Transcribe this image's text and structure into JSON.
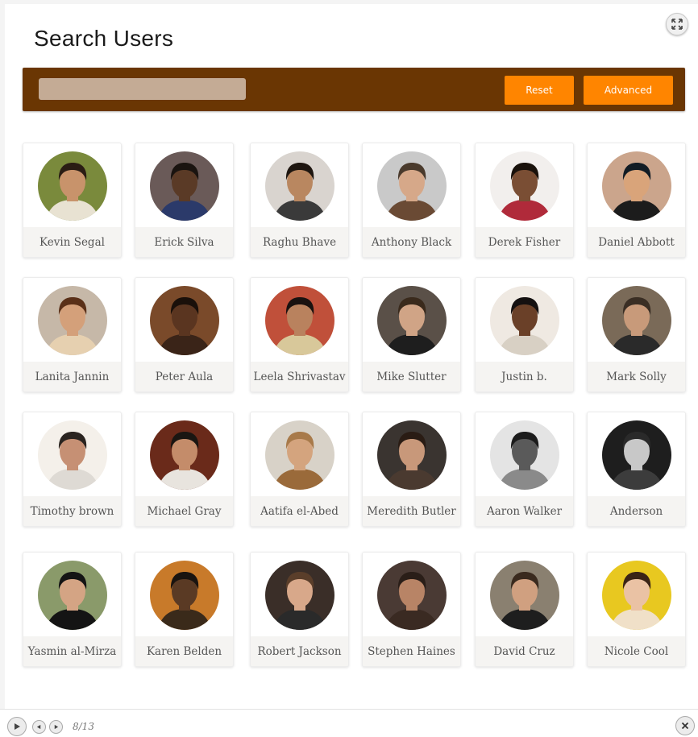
{
  "page": {
    "title": "Search Users"
  },
  "search": {
    "placeholder": "",
    "value": "",
    "reset_label": "Reset",
    "advanced_label": "Advanced"
  },
  "colors": {
    "search_bar_bg": "#6a3603",
    "search_input_bg": "#c4ab95",
    "button_bg": "#ff8500",
    "card_band_bg": "#f5f4f2"
  },
  "users": [
    {
      "name": "Kevin Segal",
      "bg": "#7a8a3c",
      "skin": "#c8936b",
      "hair": "#2a1d14",
      "shirt": "#e8e2d2"
    },
    {
      "name": "Erick Silva",
      "bg": "#6a5a58",
      "skin": "#5a3a26",
      "hair": "#1a1410",
      "shirt": "#2b3a6a"
    },
    {
      "name": "Raghu Bhave",
      "bg": "#d9d4cf",
      "skin": "#b98760",
      "hair": "#1e1610",
      "shirt": "#3a3a3a"
    },
    {
      "name": "Anthony Black",
      "bg": "#c9c9c9",
      "skin": "#d6a889",
      "hair": "#4a3a2c",
      "shirt": "#6a4a34"
    },
    {
      "name": "Derek Fisher",
      "bg": "#f2efed",
      "skin": "#7a4e34",
      "hair": "#1a120c",
      "shirt": "#b02a3a"
    },
    {
      "name": "Daniel Abbott",
      "bg": "#cba58c",
      "skin": "#d9a47a",
      "hair": "#121c24",
      "shirt": "#1c1c1c"
    },
    {
      "name": "Lanita Jannin",
      "bg": "#c6b8a8",
      "skin": "#d4a07a",
      "hair": "#5a3018",
      "shirt": "#e6d0b0"
    },
    {
      "name": "Peter Aula",
      "bg": "#7a4a2a",
      "skin": "#5a3520",
      "hair": "#1a100a",
      "shirt": "#3a2418"
    },
    {
      "name": "Leela Shrivastav",
      "bg": "#c0503a",
      "skin": "#b9825e",
      "hair": "#1a1210",
      "shirt": "#d8c89a"
    },
    {
      "name": "Mike Slutter",
      "bg": "#5a5048",
      "skin": "#d0a486",
      "hair": "#3a2a1c",
      "shirt": "#1e1e1e"
    },
    {
      "name": "Justin b.",
      "bg": "#efe9e2",
      "skin": "#6a4028",
      "hair": "#141010",
      "shirt": "#d8d0c4"
    },
    {
      "name": "Mark Solly",
      "bg": "#7a6a58",
      "skin": "#c89a7a",
      "hair": "#3a2e24",
      "shirt": "#2a2a2a"
    },
    {
      "name": "Timothy brown",
      "bg": "#f4f0ea",
      "skin": "#c69074",
      "hair": "#2a2420",
      "shirt": "#dedad4"
    },
    {
      "name": "Michael Gray",
      "bg": "#6a2a1a",
      "skin": "#c48c6a",
      "hair": "#1a1612",
      "shirt": "#e8e4de"
    },
    {
      "name": "Aatifa el-Abed",
      "bg": "#d8d2c8",
      "skin": "#d4a47e",
      "hair": "#a87a4a",
      "shirt": "#9a6a3a"
    },
    {
      "name": "Meredith Butler",
      "bg": "#3a3430",
      "skin": "#c8987a",
      "hair": "#2a1c14",
      "shirt": "#4a3a30"
    },
    {
      "name": "Aaron Walker",
      "bg": "#e4e4e4",
      "skin": "#5a5a5a",
      "hair": "#1c1c1c",
      "shirt": "#8a8a8a"
    },
    {
      "name": "Anderson",
      "bg": "#1e1e1e",
      "skin": "#c8c8c8",
      "hair": "#2a2a2a",
      "shirt": "#3c3c3c"
    },
    {
      "name": "Yasmin al-Mirza",
      "bg": "#8a9a6a",
      "skin": "#d4a484",
      "hair": "#141414",
      "shirt": "#141414"
    },
    {
      "name": "Karen Belden",
      "bg": "#c87a2a",
      "skin": "#5a3a24",
      "hair": "#1a1410",
      "shirt": "#3a2a1a"
    },
    {
      "name": "Robert Jackson",
      "bg": "#3a2e28",
      "skin": "#d8a88a",
      "hair": "#5a3e2a",
      "shirt": "#2a2a2a"
    },
    {
      "name": "Stephen Haines",
      "bg": "#4a3a34",
      "skin": "#b88466",
      "hair": "#2a1e18",
      "shirt": "#3a2a22"
    },
    {
      "name": "David Cruz",
      "bg": "#8a8070",
      "skin": "#d0a080",
      "hair": "#3a2a1e",
      "shirt": "#1e1e1e"
    },
    {
      "name": "Nicole Cool",
      "bg": "#e8c820",
      "skin": "#eac2a4",
      "hair": "#3a2416",
      "shirt": "#f0e0c8"
    }
  ],
  "footer": {
    "page_counter": "8/13"
  }
}
